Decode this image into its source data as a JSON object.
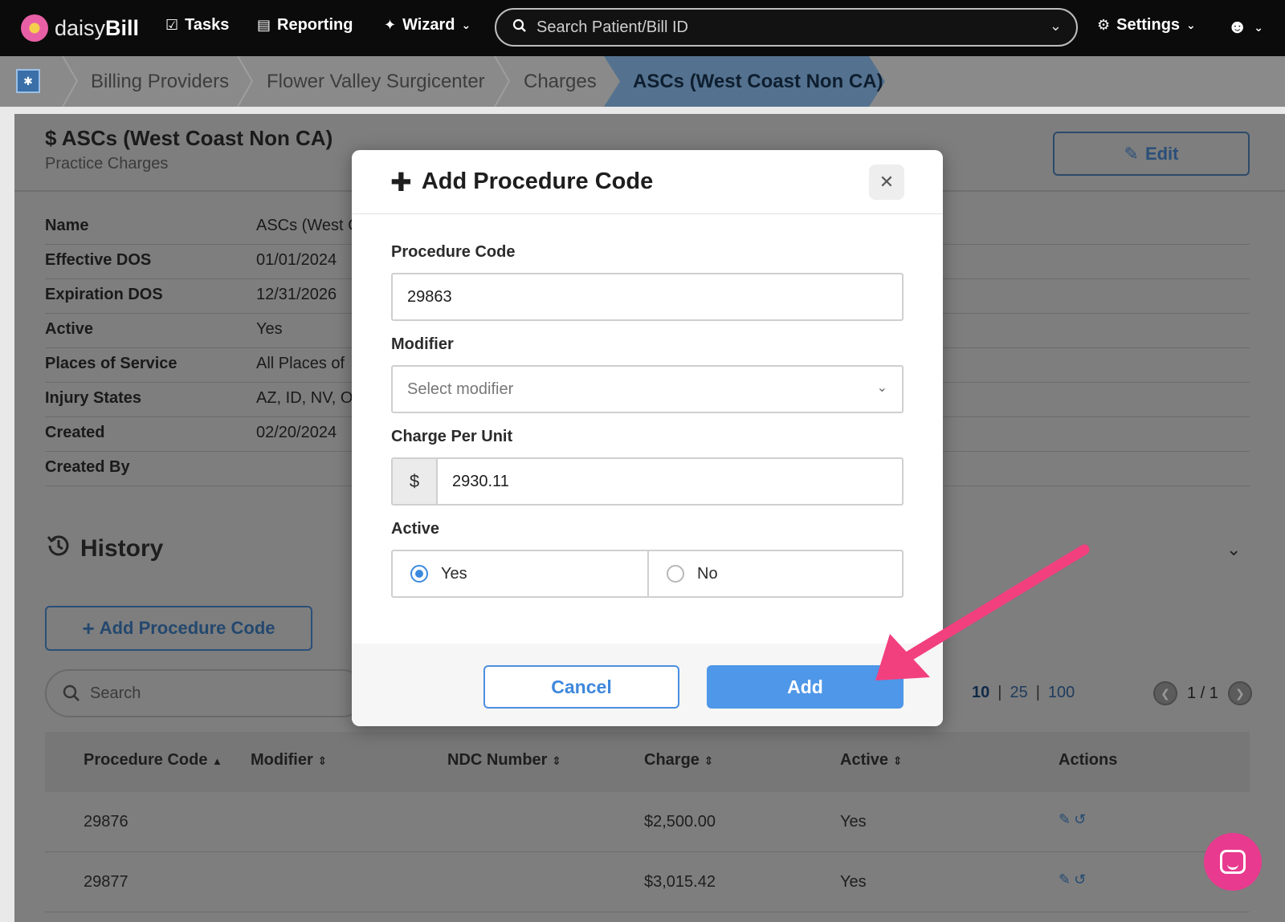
{
  "nav": {
    "logo_light": "daisy",
    "logo_bold": "Bill",
    "tasks": "Tasks",
    "reporting": "Reporting",
    "wizard": "Wizard",
    "search_placeholder": "Search Patient/Bill ID",
    "settings": "Settings"
  },
  "breadcrumb": {
    "items": [
      "Billing Providers",
      "Flower Valley Surgicenter",
      "Charges"
    ],
    "active": "ASCs (West Coast Non CA)"
  },
  "page": {
    "title": "$ ASCs (West Coast Non CA)",
    "subtitle": "Practice Charges",
    "edit_label": "Edit",
    "details": [
      {
        "label": "Name",
        "value": "ASCs (West C"
      },
      {
        "label": "Effective DOS",
        "value": "01/01/2024"
      },
      {
        "label": "Expiration DOS",
        "value": "12/31/2026"
      },
      {
        "label": "Active",
        "value": "Yes"
      },
      {
        "label": "Places of Service",
        "value": "All Places of"
      },
      {
        "label": "Injury States",
        "value": "AZ, ID, NV, O"
      },
      {
        "label": "Created",
        "value": "02/20/2024"
      },
      {
        "label": "Created By",
        "value": ""
      }
    ],
    "history_title": "History",
    "add_code_label": "Add Procedure Code",
    "table_search_placeholder": "Search",
    "page_sizes": [
      "10",
      "25",
      "100"
    ],
    "page_indicator": "1 / 1",
    "table": {
      "headers": [
        "Procedure Code",
        "Modifier",
        "NDC Number",
        "Charge",
        "Active",
        "Actions"
      ],
      "rows": [
        {
          "code": "29876",
          "modifier": "",
          "ndc": "",
          "charge": "$2,500.00",
          "active": "Yes"
        },
        {
          "code": "29877",
          "modifier": "",
          "ndc": "",
          "charge": "$3,015.42",
          "active": "Yes"
        }
      ]
    }
  },
  "modal": {
    "title": "Add Procedure Code",
    "procedure_code_label": "Procedure Code",
    "procedure_code_value": "29863",
    "modifier_label": "Modifier",
    "modifier_placeholder": "Select modifier",
    "charge_label": "Charge Per Unit",
    "currency_symbol": "$",
    "charge_value": "2930.11",
    "active_label": "Active",
    "active_yes": "Yes",
    "active_no": "No",
    "selected_active": "Yes",
    "cancel_label": "Cancel",
    "add_label": "Add"
  },
  "colors": {
    "accent": "#4f97e8",
    "annotation_arrow": "#f23f7e",
    "chat": "#e83a8e"
  }
}
